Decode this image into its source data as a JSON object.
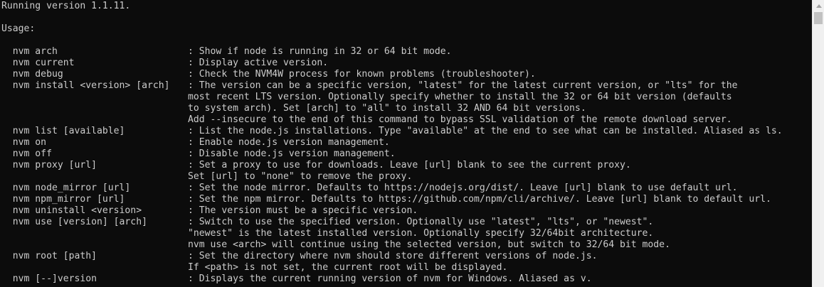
{
  "header": {
    "version_line": "Running version 1.1.11.",
    "usage_label": "Usage:"
  },
  "commands": [
    {
      "cmd": "  nvm arch",
      "desc": "Show if node is running in 32 or 64 bit mode.",
      "more": []
    },
    {
      "cmd": "  nvm current",
      "desc": "Display active version.",
      "more": []
    },
    {
      "cmd": "  nvm debug",
      "desc": "Check the NVM4W process for known problems (troubleshooter).",
      "more": []
    },
    {
      "cmd": "  nvm install <version> [arch]",
      "desc": "The version can be a specific version, \"latest\" for the latest current version, or \"lts\" for the",
      "more": [
        "most recent LTS version. Optionally specify whether to install the 32 or 64 bit version (defaults",
        "to system arch). Set [arch] to \"all\" to install 32 AND 64 bit versions.",
        "Add --insecure to the end of this command to bypass SSL validation of the remote download server."
      ]
    },
    {
      "cmd": "  nvm list [available]",
      "desc": "List the node.js installations. Type \"available\" at the end to see what can be installed. Aliased as ls.",
      "more": []
    },
    {
      "cmd": "  nvm on",
      "desc": "Enable node.js version management.",
      "more": []
    },
    {
      "cmd": "  nvm off",
      "desc": "Disable node.js version management.",
      "more": []
    },
    {
      "cmd": "  nvm proxy [url]",
      "desc": "Set a proxy to use for downloads. Leave [url] blank to see the current proxy.",
      "more": [
        "Set [url] to \"none\" to remove the proxy."
      ]
    },
    {
      "cmd": "  nvm node_mirror [url]",
      "desc": "Set the node mirror. Defaults to https://nodejs.org/dist/. Leave [url] blank to use default url.",
      "more": []
    },
    {
      "cmd": "  nvm npm_mirror [url]",
      "desc": "Set the npm mirror. Defaults to https://github.com/npm/cli/archive/. Leave [url] blank to default url.",
      "more": []
    },
    {
      "cmd": "  nvm uninstall <version>",
      "desc": "The version must be a specific version.",
      "more": []
    },
    {
      "cmd": "  nvm use [version] [arch]",
      "desc": "Switch to use the specified version. Optionally use \"latest\", \"lts\", or \"newest\".",
      "more": [
        "\"newest\" is the latest installed version. Optionally specify 32/64bit architecture.",
        "nvm use <arch> will continue using the selected version, but switch to 32/64 bit mode."
      ]
    },
    {
      "cmd": "  nvm root [path]",
      "desc": "Set the directory where nvm should store different versions of node.js.",
      "more": [
        "If <path> is not set, the current root will be displayed."
      ]
    },
    {
      "cmd": "  nvm [--]version",
      "desc": "Displays the current running version of nvm for Windows. Aliased as v.",
      "more": []
    }
  ],
  "separator": ": "
}
